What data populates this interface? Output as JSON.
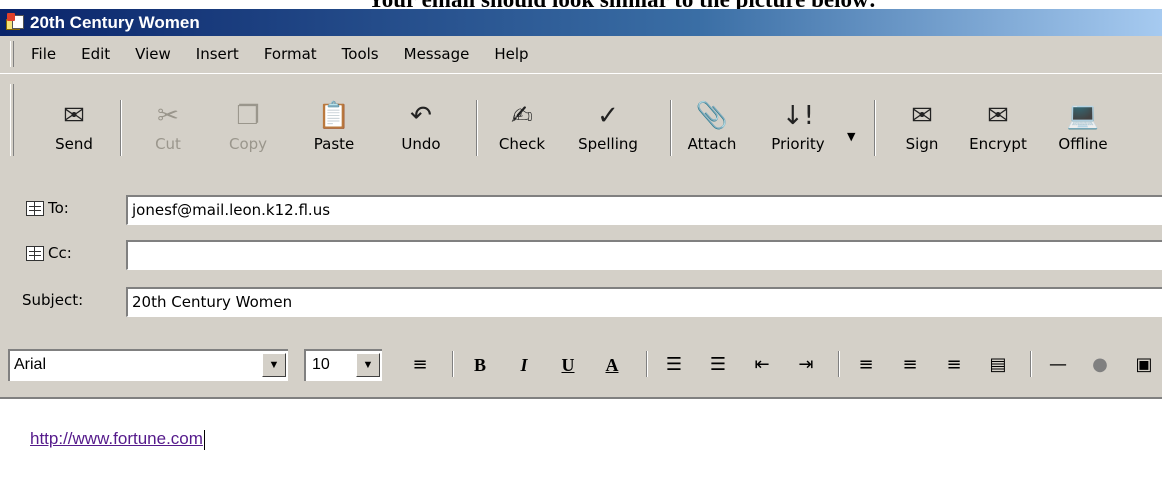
{
  "doc": {
    "heading": "Your email should look similar to the picture below:"
  },
  "window": {
    "title": "20th Century Women"
  },
  "menubar": {
    "items": [
      "File",
      "Edit",
      "View",
      "Insert",
      "Format",
      "Tools",
      "Message",
      "Help"
    ]
  },
  "toolbar": {
    "buttons": [
      {
        "label": "Send",
        "icon": "send-icon",
        "enabled": true
      },
      {
        "label": "Cut",
        "icon": "scissors-icon",
        "enabled": false
      },
      {
        "label": "Copy",
        "icon": "copy-icon",
        "enabled": false
      },
      {
        "label": "Paste",
        "icon": "paste-icon",
        "enabled": true
      },
      {
        "label": "Undo",
        "icon": "undo-icon",
        "enabled": true
      },
      {
        "label": "Check",
        "icon": "check-names-icon",
        "enabled": true
      },
      {
        "label": "Spelling",
        "icon": "spelling-icon",
        "enabled": true
      },
      {
        "label": "Attach",
        "icon": "paperclip-icon",
        "enabled": true
      },
      {
        "label": "Priority",
        "icon": "priority-icon",
        "enabled": true
      },
      {
        "label": "Sign",
        "icon": "sign-icon",
        "enabled": true
      },
      {
        "label": "Encrypt",
        "icon": "encrypt-icon",
        "enabled": true
      },
      {
        "label": "Offline",
        "icon": "offline-icon",
        "enabled": true
      }
    ]
  },
  "header": {
    "to_label": "To:",
    "to_value": "jonesf@mail.leon.k12.fl.us",
    "cc_label": "Cc:",
    "cc_value": "",
    "subject_label": "Subject:",
    "subject_value": "20th Century Women"
  },
  "format": {
    "font": "Arial",
    "size": "10",
    "bold": "B",
    "italic": "I",
    "underline": "U",
    "font_color": "A"
  },
  "body": {
    "text": "http://www.fortune.com"
  },
  "colors": {
    "titlebar": "#0a246a",
    "chrome": "#d4d0c8",
    "link": "#551a8b"
  }
}
